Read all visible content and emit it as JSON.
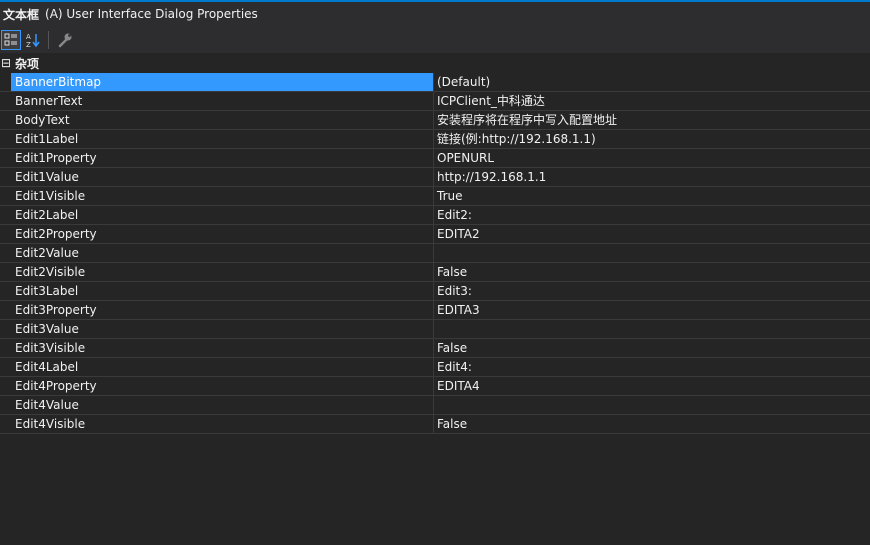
{
  "window": {
    "object_name": "文本框",
    "object_type": "(A)  User Interface Dialog Properties"
  },
  "toolbar": {
    "categorized": {
      "icon": "categorized-icon",
      "active": true
    },
    "alphabetical": {
      "icon": "sort-az-icon",
      "active": false
    },
    "property_pages": {
      "icon": "wrench-icon",
      "active": false
    }
  },
  "category": {
    "toggle": "⊟",
    "label": "杂项"
  },
  "properties": [
    {
      "name": "BannerBitmap",
      "value": "(Default)",
      "selected": true
    },
    {
      "name": "BannerText",
      "value": "ICPClient_中科通达"
    },
    {
      "name": "BodyText",
      "value": "安装程序将在程序中写入配置地址"
    },
    {
      "name": "Edit1Label",
      "value": "链接(例:http://192.168.1.1)"
    },
    {
      "name": "Edit1Property",
      "value": "OPENURL"
    },
    {
      "name": "Edit1Value",
      "value": "http://192.168.1.1"
    },
    {
      "name": "Edit1Visible",
      "value": "True"
    },
    {
      "name": "Edit2Label",
      "value": "Edit2:"
    },
    {
      "name": "Edit2Property",
      "value": "EDITA2"
    },
    {
      "name": "Edit2Value",
      "value": ""
    },
    {
      "name": "Edit2Visible",
      "value": "False"
    },
    {
      "name": "Edit3Label",
      "value": "Edit3:"
    },
    {
      "name": "Edit3Property",
      "value": "EDITA3"
    },
    {
      "name": "Edit3Value",
      "value": ""
    },
    {
      "name": "Edit3Visible",
      "value": "False"
    },
    {
      "name": "Edit4Label",
      "value": "Edit4:"
    },
    {
      "name": "Edit4Property",
      "value": "EDITA4"
    },
    {
      "name": "Edit4Value",
      "value": ""
    },
    {
      "name": "Edit4Visible",
      "value": "False"
    }
  ]
}
